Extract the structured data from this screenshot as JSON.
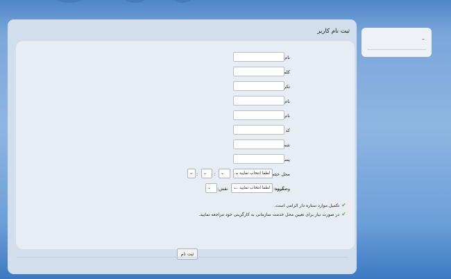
{
  "colors": {
    "background": "#6c9fd8",
    "panel": "#d2deec",
    "form_box": "#e8edf4",
    "required": "#e0261c",
    "check": "#5fae3b"
  },
  "form": {
    "title": "ثبت نام کاربر",
    "required_mark": "*",
    "fields": [
      {
        "label": "نام کاربری:",
        "required": true,
        "value": ""
      },
      {
        "label": "کلمه عبور:",
        "required": true,
        "value": ""
      },
      {
        "label": "تکرار کلمه عبور:",
        "required": true,
        "value": ""
      },
      {
        "label": "نام:",
        "required": true,
        "value": ""
      },
      {
        "label": "نام خانوادگی:",
        "required": true,
        "value": ""
      },
      {
        "label": "کد ملی:",
        "required": true,
        "value": ""
      },
      {
        "label": "شماره همراه:",
        "required": true,
        "value": ""
      },
      {
        "label": "پست الکترونیکی:",
        "required": false,
        "value": ""
      }
    ],
    "service_location": {
      "label": "محل خدمت:",
      "required": true,
      "separator": ":",
      "select1": "لطفا انتخاب نمایید ...",
      "select2": "",
      "select3": "",
      "select4": ""
    },
    "status": {
      "label": "وضعیت:",
      "required": true,
      "group_label": "گروه:",
      "group_select": "لطفا انتخاب نمایید ...",
      "role_label": "نقش:",
      "role_select": ""
    },
    "notes": [
      "تکمیل موارد ستاره دار الزامی است.",
      "در صورت نیاز برای تعیین محل خدمت سازمانی به کارگزینی خود مراجعه نمایید."
    ],
    "check_icon": "check-icon",
    "submit_label": "ثبت نام"
  },
  "side_panel": {
    "text": "–"
  }
}
